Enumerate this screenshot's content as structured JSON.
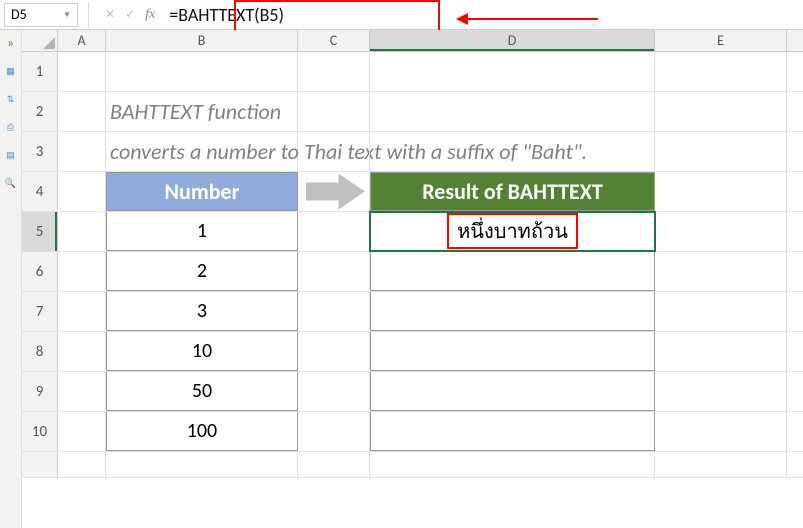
{
  "namebox": "D5",
  "formula": "=BAHTTEXT(B5)",
  "columns": [
    "A",
    "B",
    "C",
    "D",
    "E"
  ],
  "rows": [
    "1",
    "2",
    "3",
    "4",
    "5",
    "6",
    "7",
    "8",
    "9",
    "10"
  ],
  "desc_line1": "BAHTTEXT function",
  "desc_line2": "converts a number to Thai text with a suffix of \"Baht\".",
  "headers": {
    "number": "Number",
    "result": "Result of BAHTTEXT"
  },
  "numbers": [
    "1",
    "2",
    "3",
    "10",
    "50",
    "100"
  ],
  "results": [
    "หนึ่งบาทถ้วน",
    "",
    "",
    "",
    "",
    ""
  ],
  "active": {
    "col": "D",
    "row": "5"
  }
}
